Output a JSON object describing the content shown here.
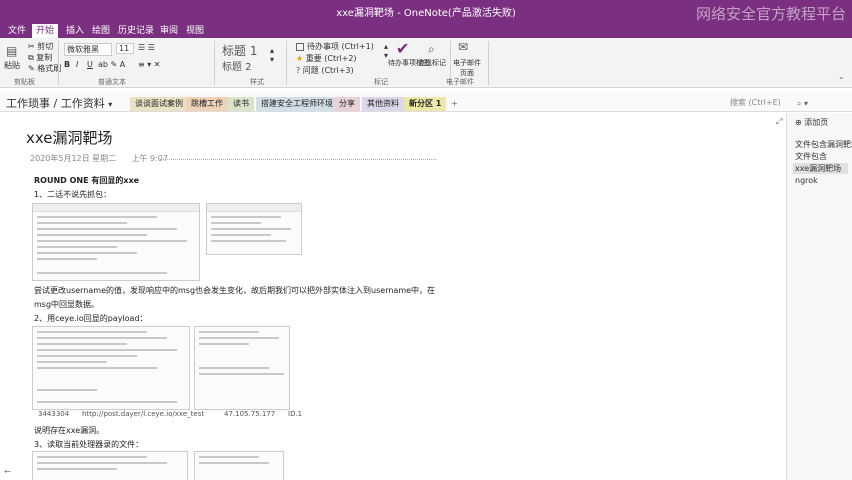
{
  "app": {
    "window_title": "xxe漏洞靶场 - OneNote(产品激活失败)",
    "watermark": "网络安全官方教程平台"
  },
  "ribbon_tabs": [
    "文件",
    "开始",
    "插入",
    "绘图",
    "历史记录",
    "审阅",
    "视图"
  ],
  "ribbon": {
    "paste": "粘贴",
    "cut": "剪切",
    "copy": "复制",
    "format_painter": "格式刷",
    "font_name": "微软雅黑",
    "font_size": "11",
    "style_h1": "标题 1",
    "style_h2": "标题 2",
    "tag_todo": "待办事项 (Ctrl+1)",
    "tag_important": "重要 (Ctrl+2)",
    "tag_question": "问题 (Ctrl+3)",
    "todo_tag_btn": "待办事项标签",
    "find_tags": "查找标记",
    "email_page": "电子邮件页面",
    "group_clipboard": "剪贴板",
    "group_basic_text": "普通文本",
    "group_styles": "样式",
    "group_tags": "标记",
    "group_email": "电子邮件"
  },
  "notebook": {
    "title": "工作琐事 / 工作资料",
    "sections": [
      "谈谈面试案例",
      "跳槽工作",
      "读书",
      "搭建安全工程师环境",
      "分享",
      "其他资料",
      "新分区 1"
    ],
    "active_section": 6,
    "search_placeholder": "搜索 (Ctrl+E)"
  },
  "page": {
    "title": "xxe漏洞靶场",
    "date": "2020年5月12日 星期二",
    "time": "上午 9:07",
    "round_heading": "ROUND ONE 有回显的xxe",
    "step1": "1、二话不说先抓包：",
    "para1_line1": "尝试更改username的值，发现响应中的msg也会发生变化，故后期我们可以把外部实体注入到username中，在",
    "para1_line2": "msg中回显数据。",
    "step2": "2、用ceye.io回显的payload：",
    "log_id": "3443304",
    "log_url": "http://post.dayer/l.ceye.io/xxe_test",
    "log_ip": "47.105.75.177",
    "log_code": "ID.1",
    "conclusion": "说明存在xxe漏洞。",
    "step3": "3、读取当前处理器录的文件："
  },
  "page_list": {
    "add_page": "添加页",
    "items": [
      "文件包含漏洞靶场",
      "文件包含",
      "xxe漏洞靶场",
      "ngrok"
    ]
  }
}
